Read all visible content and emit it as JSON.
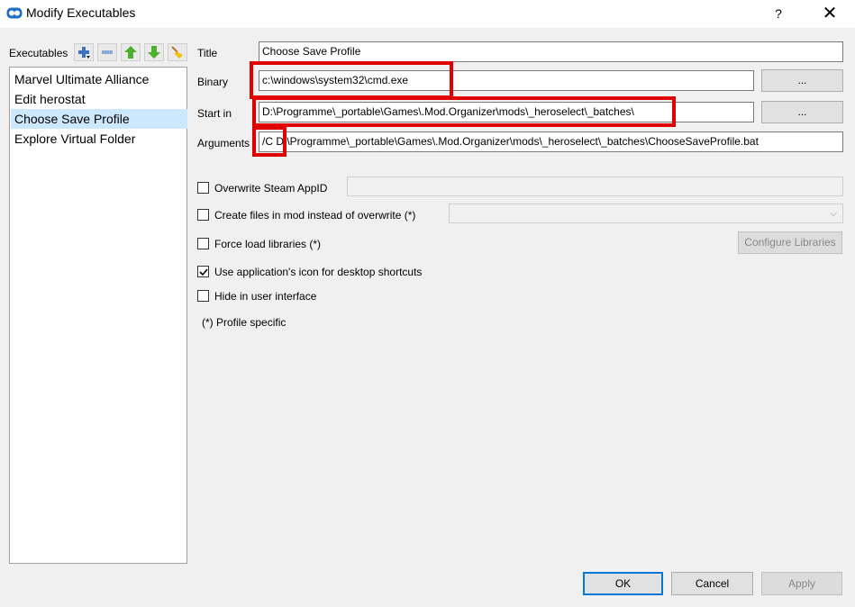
{
  "window": {
    "title": "Modify Executables",
    "help_label": "?",
    "close_label": "✕"
  },
  "left": {
    "executables_label": "Executables",
    "toolbar": [
      "add-icon",
      "remove-icon",
      "move-up-icon",
      "move-down-icon",
      "clean-icon"
    ],
    "items": [
      "Marvel Ultimate Alliance",
      "Edit herostat",
      "Choose Save Profile",
      "Explore Virtual Folder"
    ],
    "selected_index": 2
  },
  "form": {
    "title_label": "Title",
    "title_value": "Choose Save Profile",
    "binary_label": "Binary",
    "binary_value": "c:\\windows\\system32\\cmd.exe",
    "binary_browse": "...",
    "startin_label": "Start in",
    "startin_value": "D:\\Programme\\_portable\\Games\\.Mod.Organizer\\mods\\_heroselect\\_batches\\",
    "startin_browse": "...",
    "arguments_label": "Arguments",
    "arguments_value": "/C D:\\Programme\\_portable\\Games\\.Mod.Organizer\\mods\\_heroselect\\_batches\\ChooseSaveProfile.bat"
  },
  "options": {
    "steam_appid_label": "Overwrite Steam AppID",
    "steam_appid_checked": false,
    "create_files_label": "Create files in mod instead of overwrite (*)",
    "create_files_checked": false,
    "force_load_label": "Force load libraries (*)",
    "force_load_checked": false,
    "configure_libraries": "Configure Libraries",
    "use_icon_label": "Use application's icon for desktop shortcuts",
    "use_icon_checked": true,
    "hide_label": "Hide in user interface",
    "hide_checked": false,
    "profile_note": "(*) Profile specific"
  },
  "buttons": {
    "ok": "OK",
    "cancel": "Cancel",
    "apply": "Apply"
  },
  "colors": {
    "highlight_red": "#e00000",
    "selection": "#cce8ff",
    "default_button_border": "#0078d7"
  }
}
